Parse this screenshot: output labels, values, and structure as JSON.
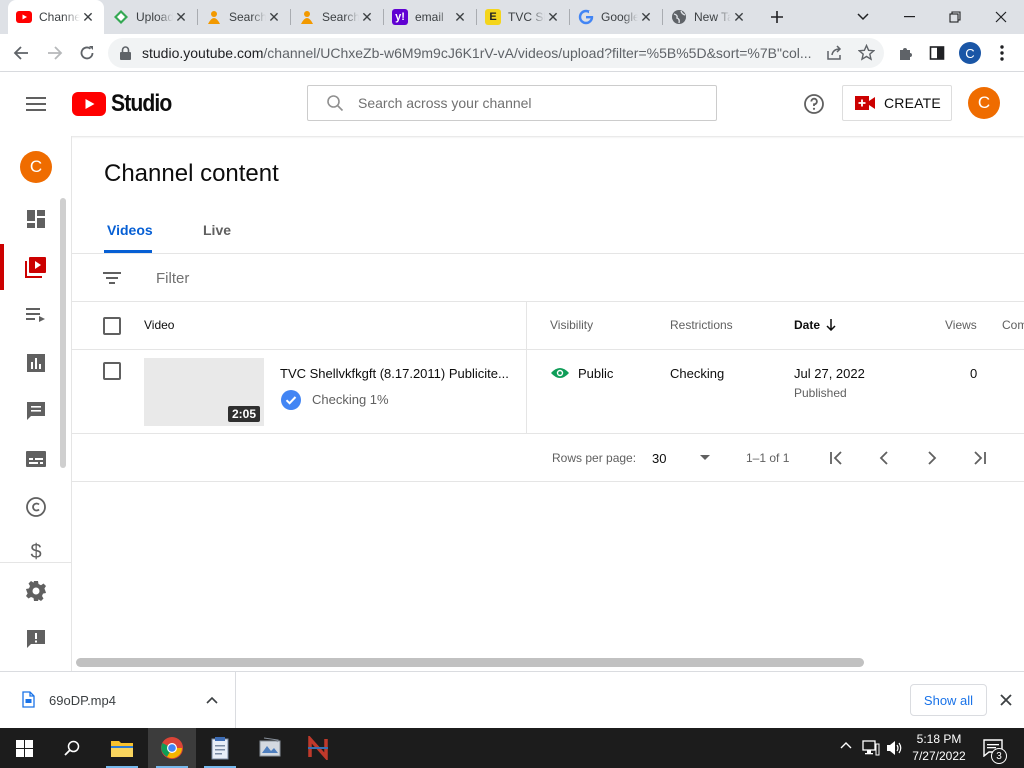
{
  "browser": {
    "tabs": [
      {
        "title": "Channel content - YouTube Studio",
        "icon": "youtube-icon",
        "active": true
      },
      {
        "title": "Upload",
        "icon": "upload-site-icon"
      },
      {
        "title": "Search",
        "icon": "search-person-icon"
      },
      {
        "title": "Search",
        "icon": "search-person-icon"
      },
      {
        "title": "email",
        "icon": "yahoo-icon"
      },
      {
        "title": "TVC Shell",
        "icon": "e-letter-icon"
      },
      {
        "title": "Google",
        "icon": "google-icon"
      },
      {
        "title": "New Tab",
        "icon": "globe-icon"
      }
    ],
    "url_host": "studio.youtube.com",
    "url_path": "/channel/UChxeZb-w6M9m9cJ6K1rV-vA/videos/upload?filter=%5B%5D&sort=%7B\"col...",
    "profile_initial": "C"
  },
  "studio": {
    "logo_text": "Studio",
    "search_placeholder": "Search across your channel",
    "create_label": "CREATE",
    "avatar_initial": "C",
    "page_title": "Channel content",
    "tabs": [
      "Videos",
      "Live"
    ],
    "filter_placeholder": "Filter",
    "columns": {
      "video": "Video",
      "visibility": "Visibility",
      "restrictions": "Restrictions",
      "date": "Date",
      "views": "Views",
      "comments": "Com"
    },
    "rows": [
      {
        "title": "TVC Shellvkfkgft (8.17.2011) Publicite...",
        "duration": "2:05",
        "status": "Checking 1%",
        "visibility": "Public",
        "restrictions": "Checking",
        "date": "Jul 27, 2022",
        "date_sub": "Published",
        "views": "0"
      }
    ],
    "pagination": {
      "rows_per_page_label": "Rows per page:",
      "rows_per_page": "30",
      "range": "1–1 of 1"
    }
  },
  "downloads": {
    "file": "69oDP.mp4",
    "show_all": "Show all"
  },
  "taskbar": {
    "time": "5:18 PM",
    "date": "7/27/2022",
    "notifications": "3"
  },
  "colors": {
    "youtube_red": "#ff0000",
    "link_blue": "#065fd4",
    "avatar_orange": "#ef6c00",
    "public_green": "#0f9d58"
  }
}
